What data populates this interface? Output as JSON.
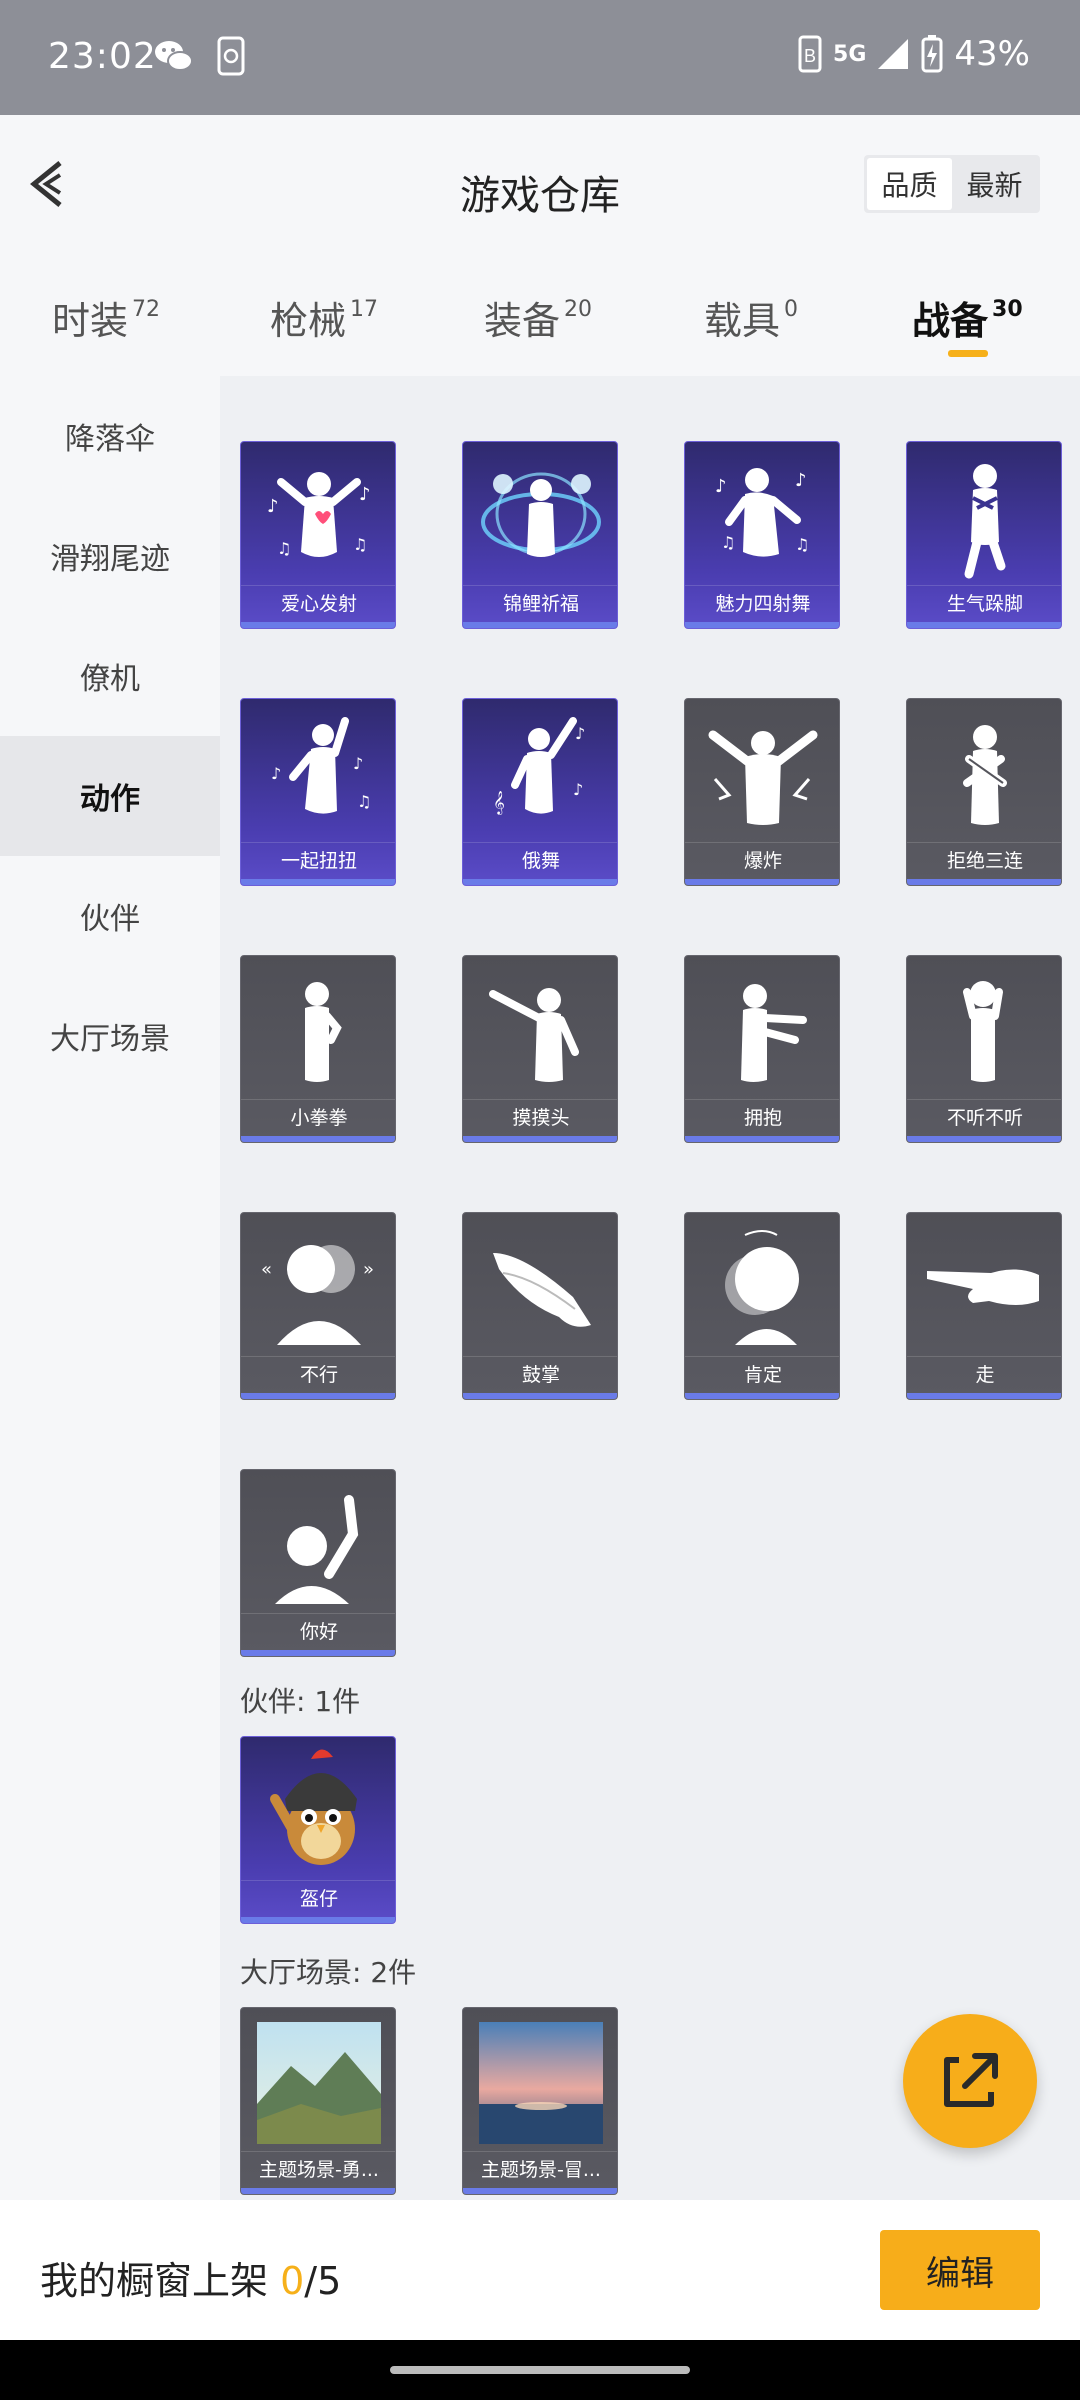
{
  "status": {
    "time": "23:02",
    "battery": "43%",
    "network": "5G"
  },
  "header": {
    "title": "游戏仓库",
    "sort_options": [
      "品质",
      "最新"
    ],
    "sort_active": "品质"
  },
  "tabs": [
    {
      "label": "时装",
      "count": "72"
    },
    {
      "label": "枪械",
      "count": "17"
    },
    {
      "label": "装备",
      "count": "20"
    },
    {
      "label": "载具",
      "count": "0"
    },
    {
      "label": "战备",
      "count": "30"
    }
  ],
  "active_tab": "战备",
  "sidebar": {
    "items": [
      "降落伞",
      "滑翔尾迹",
      "僚机",
      "动作",
      "伙伴",
      "大厅场景"
    ],
    "active": "动作"
  },
  "actions": [
    {
      "name": "爱心发射",
      "rarity": "purple",
      "icon": "heart-dance-icon"
    },
    {
      "name": "锦鲤祈福",
      "rarity": "purple",
      "icon": "koi-blessing-icon"
    },
    {
      "name": "魅力四射舞",
      "rarity": "purple",
      "icon": "charm-dance-icon"
    },
    {
      "name": "生气跺脚",
      "rarity": "purple",
      "icon": "angry-stomp-icon"
    },
    {
      "name": "一起扭扭",
      "rarity": "purple",
      "icon": "twist-dance-icon"
    },
    {
      "name": "俄舞",
      "rarity": "purple",
      "icon": "russian-dance-icon"
    },
    {
      "name": "爆炸",
      "rarity": "gray",
      "icon": "explosion-icon"
    },
    {
      "name": "拒绝三连",
      "rarity": "gray",
      "icon": "refuse-icon"
    },
    {
      "name": "小拳拳",
      "rarity": "gray",
      "icon": "little-fist-icon"
    },
    {
      "name": "摸摸头",
      "rarity": "gray",
      "icon": "pat-head-icon"
    },
    {
      "name": "拥抱",
      "rarity": "gray",
      "icon": "hug-icon"
    },
    {
      "name": "不听不听",
      "rarity": "gray",
      "icon": "cover-ears-icon"
    },
    {
      "name": "不行",
      "rarity": "gray",
      "icon": "shake-head-icon"
    },
    {
      "name": "鼓掌",
      "rarity": "gray",
      "icon": "clap-icon"
    },
    {
      "name": "肯定",
      "rarity": "gray",
      "icon": "nod-icon"
    },
    {
      "name": "走",
      "rarity": "gray",
      "icon": "point-go-icon"
    },
    {
      "name": "你好",
      "rarity": "gray",
      "icon": "wave-hello-icon"
    }
  ],
  "partner_section": {
    "title": "伙伴: 1件",
    "items": [
      {
        "name": "盔仔",
        "rarity": "purple",
        "icon": "helmet-chick-icon"
      }
    ]
  },
  "lobby_section": {
    "title": "大厅场景: 2件",
    "items": [
      {
        "name": "主题场景-勇...",
        "rarity": "gray",
        "icon": "mountain-scene-icon"
      },
      {
        "name": "主题场景-冒...",
        "rarity": "gray",
        "icon": "sea-scene-icon"
      }
    ]
  },
  "bottom": {
    "label": "我的橱窗上架",
    "current": "0",
    "total": "/5",
    "edit": "编辑"
  },
  "colors": {
    "accent": "#f7ad1a",
    "purple_card": "#4a3db0",
    "gray_card": "#55555c",
    "card_bar": "#6a7be8"
  }
}
